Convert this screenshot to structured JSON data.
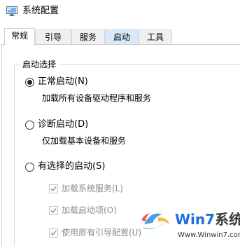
{
  "window": {
    "title": "系统配置"
  },
  "tabs": [
    {
      "label": "常规",
      "state": "active"
    },
    {
      "label": "引导",
      "state": "normal"
    },
    {
      "label": "服务",
      "state": "normal"
    },
    {
      "label": "启动",
      "state": "hovered"
    },
    {
      "label": "工具",
      "state": "normal"
    }
  ],
  "startup": {
    "group_label": "启动选择",
    "options": [
      {
        "label": "正常启动(N)",
        "checked": true,
        "description": "加载所有设备驱动程序和服务"
      },
      {
        "label": "诊断启动(D)",
        "checked": false,
        "description": "仅加载基本设备和服务"
      },
      {
        "label": "有选择的启动(S)",
        "checked": false
      }
    ],
    "selective_items": [
      {
        "label": "加载系统服务(L)",
        "checked": true,
        "disabled": true
      },
      {
        "label": "加载启动项(O)",
        "checked": true,
        "disabled": true
      },
      {
        "label": "使用原有引导配置(U)",
        "checked": true,
        "disabled": true
      }
    ]
  },
  "watermark": {
    "brand_prefix": "Win7",
    "brand_suffix": "系统之家",
    "url": "Www.Winwin7.com"
  },
  "colors": {
    "tab_hover": "#d8eaf9",
    "disabled_text": "#8c8c8c",
    "watermark_blue": "#1a6fd8"
  }
}
